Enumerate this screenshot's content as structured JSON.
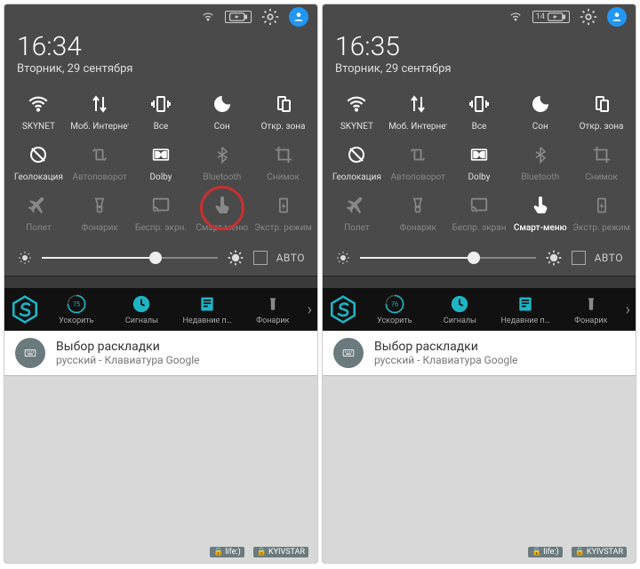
{
  "left": {
    "battery_label": "",
    "battery_icon_only": true,
    "time": "16:34",
    "date": "Вторник, 29 сентября",
    "tiles": [
      {
        "label": "SKYNET",
        "icon": "wifi",
        "active": true
      },
      {
        "label": "Моб. Интернет",
        "icon": "data",
        "active": true
      },
      {
        "label": "Все",
        "icon": "vibrate",
        "active": true
      },
      {
        "label": "Сон",
        "icon": "sleep",
        "active": true
      },
      {
        "label": "Откр. зона",
        "icon": "hotspot",
        "active": true
      },
      {
        "label": "Геолокация",
        "icon": "location-off",
        "active": true
      },
      {
        "label": "Автоповорот",
        "icon": "rotate",
        "active": false
      },
      {
        "label": "Dolby",
        "icon": "dolby",
        "active": true
      },
      {
        "label": "Bluetooth",
        "icon": "bluetooth",
        "active": false
      },
      {
        "label": "Снимок",
        "icon": "crop",
        "active": false
      },
      {
        "label": "Полет",
        "icon": "airplane",
        "active": false
      },
      {
        "label": "Фонарик",
        "icon": "torch",
        "active": false
      },
      {
        "label": "Беспр. экрн.",
        "icon": "cast",
        "active": false
      },
      {
        "label": "Смарт-меню",
        "icon": "touch",
        "active": false,
        "red_circle": true
      },
      {
        "label": "Экстр. режим",
        "icon": "saver",
        "active": false
      }
    ],
    "brightness_pct": 65,
    "auto_label": "АВТО",
    "sec": {
      "boost_pct": "75",
      "items": [
        {
          "label": "Ускорить",
          "icon": "boost"
        },
        {
          "label": "Сигналы",
          "icon": "clock",
          "accent": true
        },
        {
          "label": "Недавние п…",
          "icon": "recent",
          "accent": true
        },
        {
          "label": "Фонарик",
          "icon": "torch-bar"
        }
      ]
    },
    "notif": {
      "title": "Выбор раскладки",
      "sub": "русский - Клавиатура Google"
    },
    "bottom": {
      "a": "life:)",
      "b": "KYIVSTAR"
    }
  },
  "right": {
    "battery_label": "14",
    "time": "16:35",
    "date": "Вторник, 29 сентября",
    "tiles": [
      {
        "label": "SKYNET",
        "icon": "wifi",
        "active": true
      },
      {
        "label": "Моб. Интернет",
        "icon": "data",
        "active": true
      },
      {
        "label": "Все",
        "icon": "vibrate",
        "active": true
      },
      {
        "label": "Сон",
        "icon": "sleep",
        "active": true
      },
      {
        "label": "Откр. зона",
        "icon": "hotspot",
        "active": true
      },
      {
        "label": "Геолокация",
        "icon": "location-off",
        "active": true
      },
      {
        "label": "Автоповорот",
        "icon": "rotate",
        "active": false
      },
      {
        "label": "Dolby",
        "icon": "dolby",
        "active": true
      },
      {
        "label": "Bluetooth",
        "icon": "bluetooth",
        "active": false
      },
      {
        "label": "Снимок",
        "icon": "crop",
        "active": false
      },
      {
        "label": "Полет",
        "icon": "airplane",
        "active": false
      },
      {
        "label": "Фонарик",
        "icon": "torch",
        "active": false
      },
      {
        "label": "Беспр. экран",
        "icon": "cast",
        "active": false
      },
      {
        "label": "Смарт-меню",
        "icon": "touch",
        "active": true,
        "bright": true
      },
      {
        "label": "Экстр. режим",
        "icon": "saver",
        "active": false
      }
    ],
    "brightness_pct": 65,
    "auto_label": "АВТО",
    "sec": {
      "boost_pct": "76",
      "items": [
        {
          "label": "Ускорить",
          "icon": "boost"
        },
        {
          "label": "Сигналы",
          "icon": "clock",
          "accent": true
        },
        {
          "label": "Недавние п…",
          "icon": "recent",
          "accent": true
        },
        {
          "label": "Фонарик",
          "icon": "torch-bar"
        }
      ]
    },
    "notif": {
      "title": "Выбор раскладки",
      "sub": "русский - Клавиатура Google"
    },
    "bottom": {
      "a": "life:)",
      "b": "KYIVSTAR"
    }
  }
}
